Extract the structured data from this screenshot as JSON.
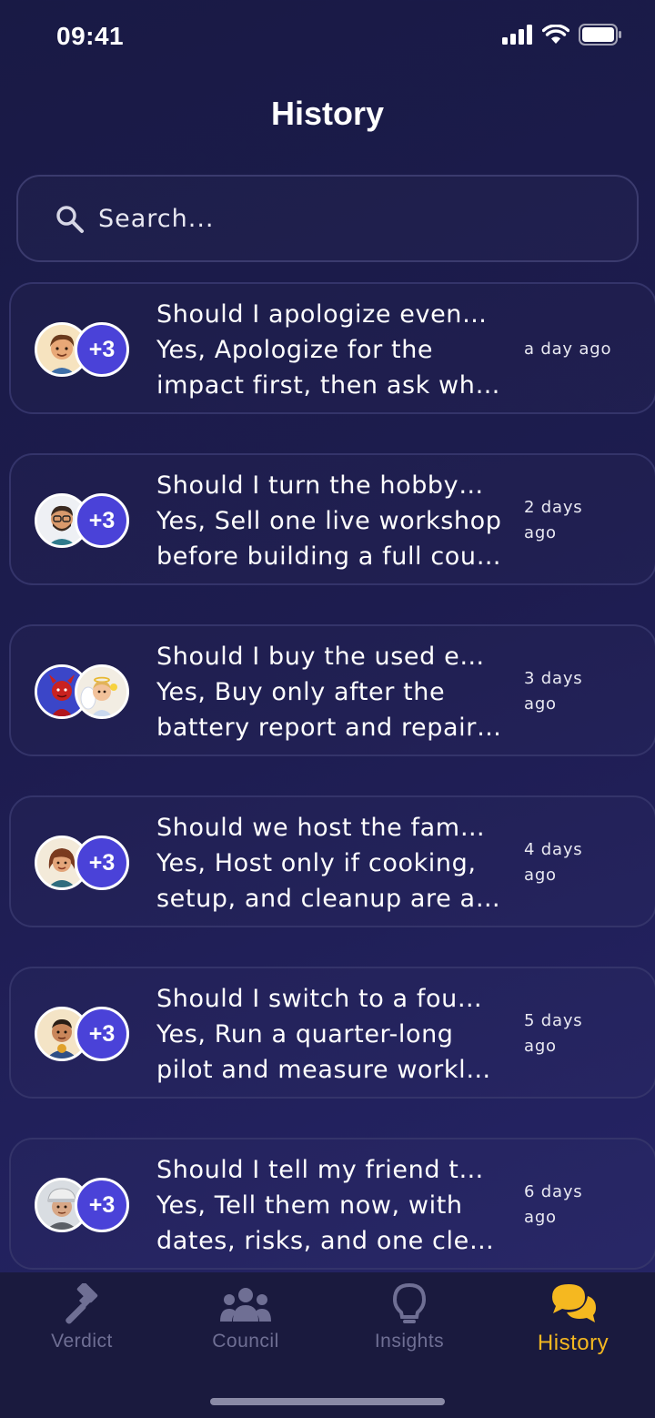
{
  "status_bar": {
    "time": "09:41"
  },
  "page": {
    "title": "History"
  },
  "search": {
    "placeholder": "Search..."
  },
  "history": [
    {
      "title": "Should I apologize even…",
      "verdict_line1": "Yes, Apologize for the",
      "verdict_line2": "impact first, then ask wha…",
      "time_line1": "a day ago",
      "time_line2": "",
      "more": "+3"
    },
    {
      "title": "Should I turn the hobby…",
      "verdict_line1": "Yes, Sell one live workshop",
      "verdict_line2": "before building a full cour…",
      "time_line1": "2 days",
      "time_line2": "ago",
      "more": "+3"
    },
    {
      "title": "Should I buy the used e…",
      "verdict_line1": "Yes, Buy only after the",
      "verdict_line2": "battery report and repair …",
      "time_line1": "3 days",
      "time_line2": "ago",
      "more": ""
    },
    {
      "title": "Should we host the fam…",
      "verdict_line1": "Yes, Host only if cooking,",
      "verdict_line2": "setup, and cleanup are as…",
      "time_line1": "4 days",
      "time_line2": "ago",
      "more": "+3"
    },
    {
      "title": "Should I switch to a fou…",
      "verdict_line1": "Yes, Run a quarter-long",
      "verdict_line2": "pilot and measure workloa…",
      "time_line1": "5 days",
      "time_line2": "ago",
      "more": "+3"
    },
    {
      "title": "Should I tell my friend t…",
      "verdict_line1": "Yes, Tell them now, with",
      "verdict_line2": "dates, risks, and one clea…",
      "time_line1": "6 days",
      "time_line2": "ago",
      "more": "+3"
    }
  ],
  "tabs": [
    {
      "label": "Verdict",
      "icon": "gavel-icon"
    },
    {
      "label": "Council",
      "icon": "group-icon"
    },
    {
      "label": "Insights",
      "icon": "lightbulb-icon"
    },
    {
      "label": "History",
      "icon": "chat-bubbles-icon",
      "active": true
    }
  ],
  "colors": {
    "accent": "#f5b820",
    "badge": "#4a42d8",
    "background": "#1d1c4f",
    "inactive_tab": "#6f6f94"
  }
}
